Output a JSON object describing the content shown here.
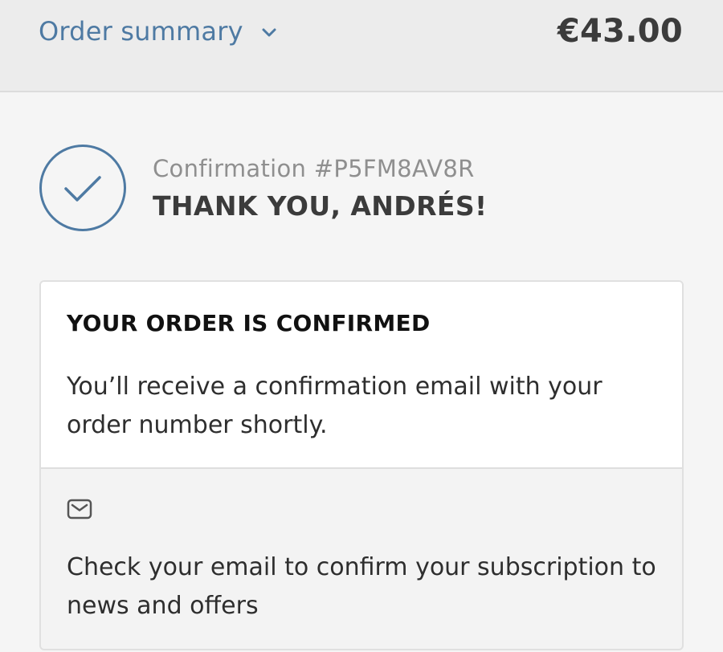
{
  "summary": {
    "toggle_label": "Order summary",
    "toggle_icon": "chevron-down-icon",
    "total": "€43.00"
  },
  "confirmation": {
    "icon": "check-circle-icon",
    "number_text": "Confirmation #P5FM8AV8R",
    "thank_you": "THANK YOU, ANDRÉS!"
  },
  "card": {
    "heading": "YOUR ORDER IS CONFIRMED",
    "message": "You’ll receive a confirmation email with your order number shortly.",
    "note_icon": "mail-icon",
    "note": "Check your email to confirm your subscription to news and offers"
  },
  "colors": {
    "accent": "#4e7aa3",
    "heading_text": "#3b3b3b",
    "muted_text": "#8f8f8f"
  }
}
